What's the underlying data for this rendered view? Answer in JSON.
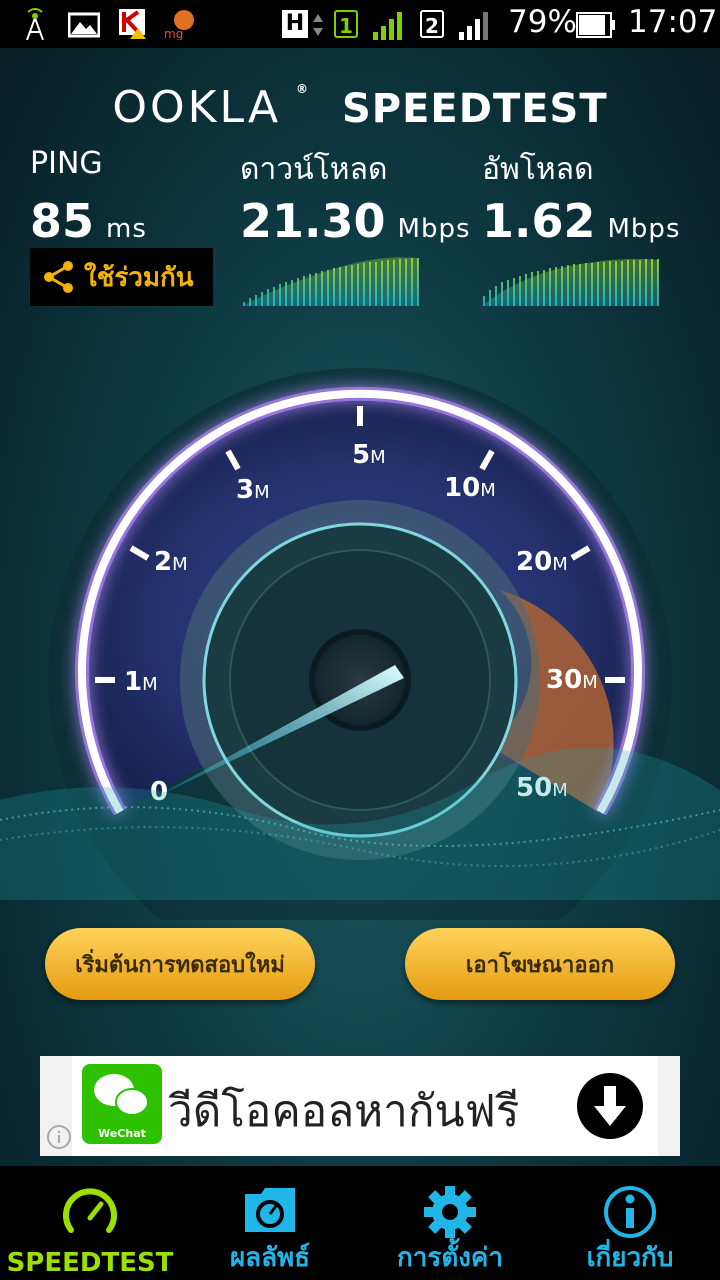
{
  "status_bar": {
    "network_type": "H",
    "sim1": "1",
    "sim2": "2",
    "battery": "79%",
    "time": "17:07",
    "icons": [
      "signal-tower-icon",
      "gallery-icon",
      "app-k-icon",
      "app-mg-icon"
    ]
  },
  "header": {
    "brand": "OOKLA",
    "product": "SPEEDTEST"
  },
  "metrics": {
    "ping": {
      "label": "PING",
      "value": "85",
      "unit": "ms"
    },
    "download": {
      "label": "ดาวน์โหลด",
      "value": "21.30",
      "unit": "Mbps"
    },
    "upload": {
      "label": "อัพโหลด",
      "value": "1.62",
      "unit": "Mbps"
    }
  },
  "share_button": {
    "label": "ใช้ร่วมกัน",
    "icon": "share-icon"
  },
  "gauge": {
    "ticks": [
      {
        "num": "0",
        "unit": ""
      },
      {
        "num": "1",
        "unit": "M"
      },
      {
        "num": "2",
        "unit": "M"
      },
      {
        "num": "3",
        "unit": "M"
      },
      {
        "num": "5",
        "unit": "M"
      },
      {
        "num": "10",
        "unit": "M"
      },
      {
        "num": "20",
        "unit": "M"
      },
      {
        "num": "30",
        "unit": "M"
      },
      {
        "num": "50",
        "unit": "M"
      }
    ],
    "needle_value": 0,
    "colors": {
      "arc": "#ffffff",
      "glow": "#9b7cff",
      "hot_zone": "#d87a2a"
    }
  },
  "buttons": {
    "restart": "เริ่มต้นการทดสอบใหม่",
    "remove_ads": "เอาโฆษณาออก"
  },
  "ad": {
    "app_name": "WeChat",
    "text": "วีดีโอคอลหากันฟรี"
  },
  "bottom_nav": [
    {
      "label": "SPEEDTEST",
      "icon": "speedometer-icon",
      "active": true
    },
    {
      "label": "ผลลัพธ์",
      "icon": "results-folder-icon",
      "active": false
    },
    {
      "label": "การตั้งค่า",
      "icon": "gear-icon",
      "active": false
    },
    {
      "label": "เกี่ยวกับ",
      "icon": "info-icon",
      "active": false
    }
  ],
  "colors": {
    "accent": "#20b7e8",
    "active_tab": "#9be000",
    "button": "#f0b428"
  }
}
